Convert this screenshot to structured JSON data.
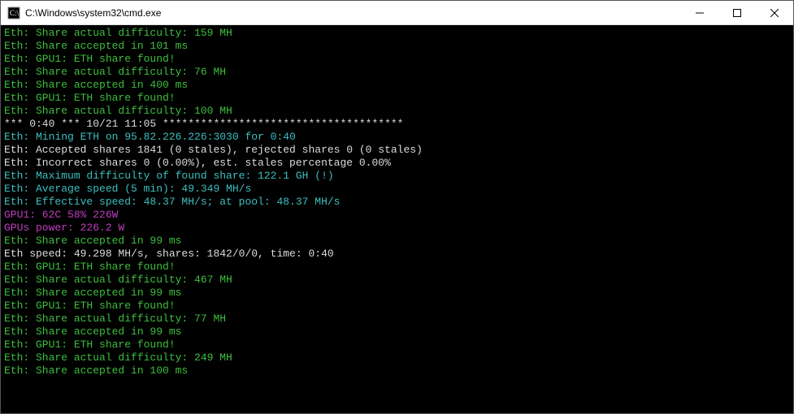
{
  "title": "C:\\Windows\\system32\\cmd.exe",
  "lines": [
    {
      "cls": "green",
      "text": "Eth: Share actual difficulty: 159 MH"
    },
    {
      "cls": "green",
      "text": "Eth: Share accepted in 101 ms"
    },
    {
      "cls": "green",
      "text": "Eth: GPU1: ETH share found!"
    },
    {
      "cls": "green",
      "text": "Eth: Share actual difficulty: 76 MH"
    },
    {
      "cls": "green",
      "text": "Eth: Share accepted in 400 ms"
    },
    {
      "cls": "green",
      "text": "Eth: GPU1: ETH share found!"
    },
    {
      "cls": "green",
      "text": "Eth: Share actual difficulty: 100 MH"
    },
    {
      "cls": "white",
      "text": ""
    },
    {
      "cls": "white",
      "text": "*** 0:40 *** 10/21 11:05 **************************************"
    },
    {
      "cls": "cyan",
      "text": "Eth: Mining ETH on 95.82.226.226:3030 for 0:40"
    },
    {
      "cls": "white",
      "text": "Eth: Accepted shares 1841 (0 stales), rejected shares 0 (0 stales)"
    },
    {
      "cls": "white",
      "text": "Eth: Incorrect shares 0 (0.00%), est. stales percentage 0.00%"
    },
    {
      "cls": "cyan",
      "text": "Eth: Maximum difficulty of found share: 122.1 GH (!)"
    },
    {
      "cls": "cyan",
      "text": "Eth: Average speed (5 min): 49.349 MH/s"
    },
    {
      "cls": "cyan",
      "text": "Eth: Effective speed: 48.37 MH/s; at pool: 48.37 MH/s"
    },
    {
      "cls": "white",
      "text": ""
    },
    {
      "cls": "magenta",
      "text": "GPU1: 62C 58% 226W"
    },
    {
      "cls": "magenta",
      "text": "GPUs power: 226.2 W"
    },
    {
      "cls": "green",
      "text": "Eth: Share accepted in 99 ms"
    },
    {
      "cls": "white",
      "text": "Eth speed: 49.298 MH/s, shares: 1842/0/0, time: 0:40"
    },
    {
      "cls": "green",
      "text": "Eth: GPU1: ETH share found!"
    },
    {
      "cls": "green",
      "text": "Eth: Share actual difficulty: 467 MH"
    },
    {
      "cls": "green",
      "text": "Eth: Share accepted in 99 ms"
    },
    {
      "cls": "green",
      "text": "Eth: GPU1: ETH share found!"
    },
    {
      "cls": "green",
      "text": "Eth: Share actual difficulty: 77 MH"
    },
    {
      "cls": "green",
      "text": "Eth: Share accepted in 99 ms"
    },
    {
      "cls": "green",
      "text": "Eth: GPU1: ETH share found!"
    },
    {
      "cls": "green",
      "text": "Eth: Share actual difficulty: 249 MH"
    },
    {
      "cls": "green",
      "text": "Eth: Share accepted in 100 ms"
    }
  ]
}
